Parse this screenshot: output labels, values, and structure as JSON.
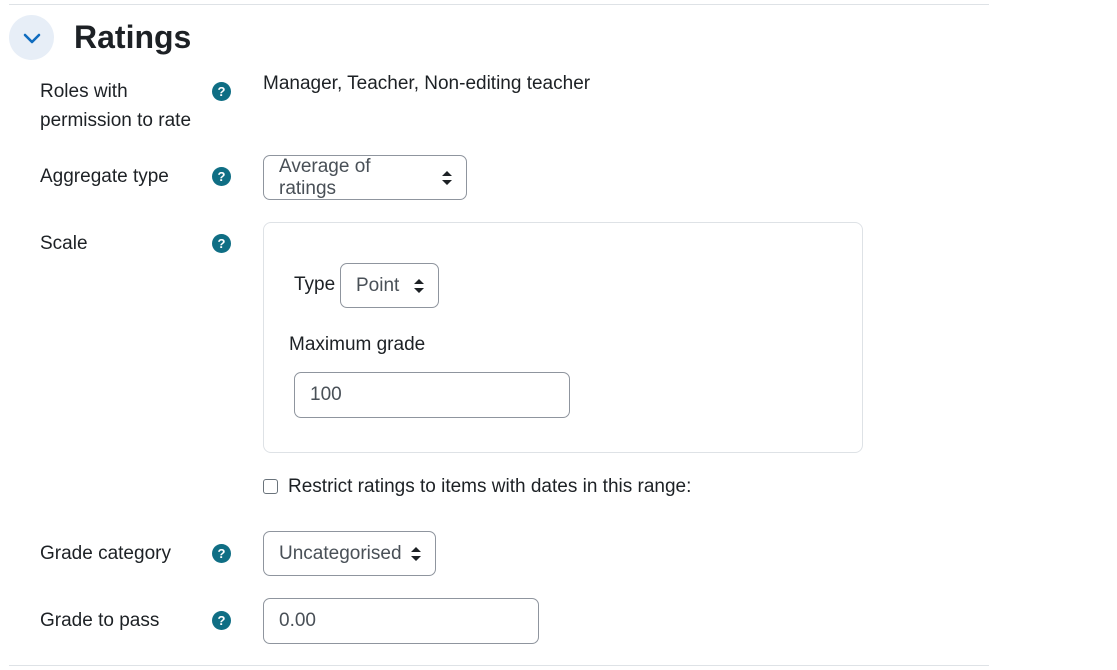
{
  "section": {
    "title": "Ratings"
  },
  "roles": {
    "label_line1": "Roles with",
    "label_line2": "permission to rate",
    "value": "Manager, Teacher, Non-editing teacher"
  },
  "aggregate": {
    "label": "Aggregate type",
    "selected": "Average of ratings"
  },
  "scale": {
    "label": "Scale",
    "type_label": "Type",
    "type_selected": "Point",
    "max_grade_label": "Maximum grade",
    "max_grade_value": "100"
  },
  "restrict": {
    "label": "Restrict ratings to items with dates in this range:",
    "checked": false
  },
  "grade_category": {
    "label": "Grade category",
    "selected": "Uncategorised"
  },
  "grade_to_pass": {
    "label": "Grade to pass",
    "value": "0.00"
  },
  "help_icon_text": "?",
  "icons": {
    "toggle": "chevron-down-icon",
    "help": "question-circle-icon",
    "select_caret": "sort-caret-icon"
  },
  "colors": {
    "help_icon": "#0f6e84",
    "toggle_bg": "#e7eef7",
    "toggle_chevron": "#0f6cbf"
  }
}
